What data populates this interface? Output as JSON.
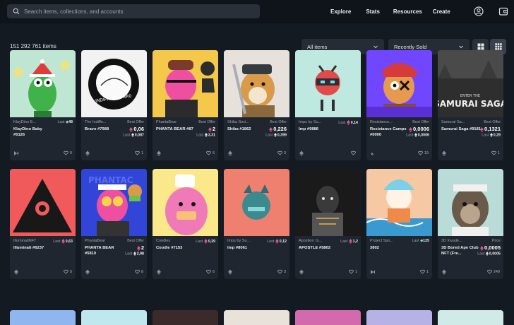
{
  "search": {
    "placeholder": "Search items, collections, and accounts"
  },
  "nav": [
    "Explore",
    "Stats",
    "Resources",
    "Create"
  ],
  "toolbar": {
    "item_count": "151 292 761 items",
    "filter_select": "All items",
    "sort_select": "Recently Sold"
  },
  "colors": {
    "background": "#141a22",
    "topbar": "#0f141b",
    "card": "#202630"
  },
  "cards": [
    {
      "collection": "KlayDino B...",
      "name": "KlayDino Baby #5126",
      "mode": "inline",
      "inline_label": "Last",
      "inline_value": "48",
      "likes": "0",
      "chain": "klaytn"
    },
    {
      "collection": "The Indiffe...",
      "name": "Bravo #7988",
      "mode": "offer",
      "label": "Best Offer",
      "price": "0,06",
      "last_label": "Last",
      "last_value": "0,087",
      "likes": "1",
      "chain": "eth"
    },
    {
      "collection": "PhantaBear",
      "name": "PHANTA BEAR #87",
      "mode": "offer",
      "label": "Best Offer",
      "price": "2",
      "last_label": "Last",
      "last_value": "3,31",
      "likes": "5",
      "chain": "eth"
    },
    {
      "collection": "Shiba Soci...",
      "name": "Shiba #1862",
      "mode": "offer",
      "label": "Best Offer",
      "price": "0,226",
      "last_label": "Last",
      "last_value": "0,399",
      "likes": "3",
      "chain": "eth"
    },
    {
      "collection": "Imps by Su...",
      "name": "Imp #9886",
      "mode": "inline",
      "inline_label": "Last",
      "inline_value": "0,14",
      "likes": "",
      "chain": "eth"
    },
    {
      "collection": "Resistance...",
      "name": "Resistance Camps #0000",
      "mode": "offer",
      "label": "Best Offer",
      "price": "0,0006",
      "last_label": "Last",
      "last_value": "0,0006",
      "likes": "19",
      "chain": "link"
    },
    {
      "collection": "Samurai Sa...",
      "name": "Samurai Saga #9181",
      "mode": "offer",
      "label": "Best Offer",
      "price": "0,1321",
      "last_label": "Last",
      "last_value": "0,29",
      "likes": "1",
      "chain": "eth"
    },
    {
      "collection": "IlluminatiNFT",
      "name": "Illuminati #6237",
      "mode": "inline",
      "inline_label": "Last",
      "inline_value": "0,63",
      "likes": "5",
      "chain": "eth"
    },
    {
      "collection": "PhantaBear",
      "name": "PHANTA BEAR #5810",
      "mode": "offer",
      "label": "Best Offer",
      "price": "2",
      "last_label": "Last",
      "last_value": "2,98",
      "likes": "8",
      "chain": "eth"
    },
    {
      "collection": "Coodles",
      "name": "Coodle #7153",
      "mode": "inline",
      "inline_label": "Last",
      "inline_value": "0,29",
      "likes": "6",
      "chain": "eth"
    },
    {
      "collection": "Imps by Su...",
      "name": "Imp #8061",
      "mode": "inline",
      "inline_label": "Last",
      "inline_value": "0,12",
      "likes": "3",
      "chain": "eth"
    },
    {
      "collection": "Apostles: G...",
      "name": "APOSTLE #5802",
      "mode": "inline",
      "inline_label": "Last",
      "inline_value": "1,2",
      "likes": "1",
      "chain": "eth"
    },
    {
      "collection": "Project Spo...",
      "name": "3802",
      "mode": "inline",
      "inline_label": "Last",
      "inline_value": "125",
      "likes": "1",
      "chain": "klaytn"
    },
    {
      "collection": "3D Invade...",
      "name": "3D Bored Ape Club NFT (Fre...",
      "mode": "offer",
      "label": "Price",
      "price": "0,0005",
      "last_label": "Last",
      "last_value": "0,0005",
      "likes": "240",
      "chain": "eth"
    }
  ]
}
